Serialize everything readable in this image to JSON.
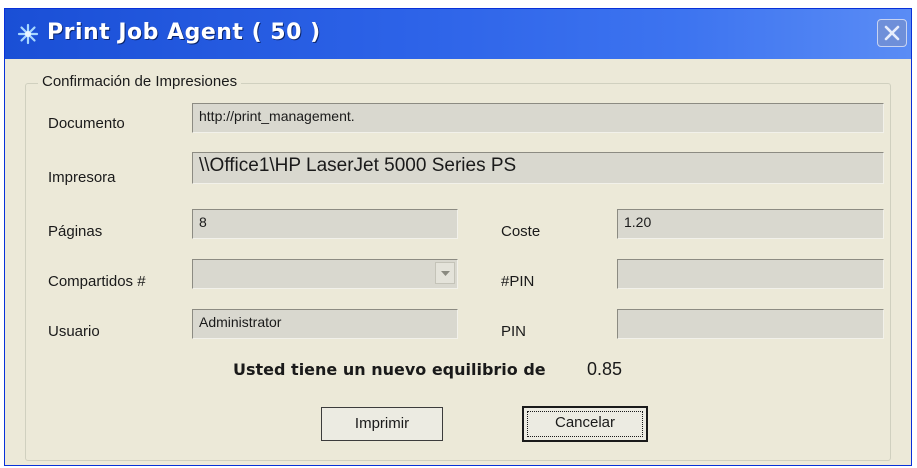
{
  "window": {
    "title": "Print Job Agent ( 50 )",
    "accent_color": "#2d63e8",
    "icon": "asterisk-icon"
  },
  "group": {
    "legend": "Confirmación de Impresiones"
  },
  "fields": {
    "documento": {
      "label": "Documento",
      "value": "http://print_management."
    },
    "impresora": {
      "label": "Impresora",
      "value": "\\\\Office1\\HP LaserJet 5000 Series PS"
    },
    "paginas": {
      "label": "Páginas",
      "value": "8"
    },
    "coste": {
      "label": "Coste",
      "value": "1.20"
    },
    "compartidos": {
      "label": "Compartidos #",
      "value": ""
    },
    "pin_hash": {
      "label": "#PIN",
      "value": ""
    },
    "usuario": {
      "label": "Usuario",
      "value": "Administrator"
    },
    "pin": {
      "label": "PIN",
      "value": ""
    }
  },
  "balance": {
    "message": "Usted tiene un nuevo equilibrio de",
    "amount": "0.85"
  },
  "buttons": {
    "print": "Imprimir",
    "cancel": "Cancelar"
  }
}
